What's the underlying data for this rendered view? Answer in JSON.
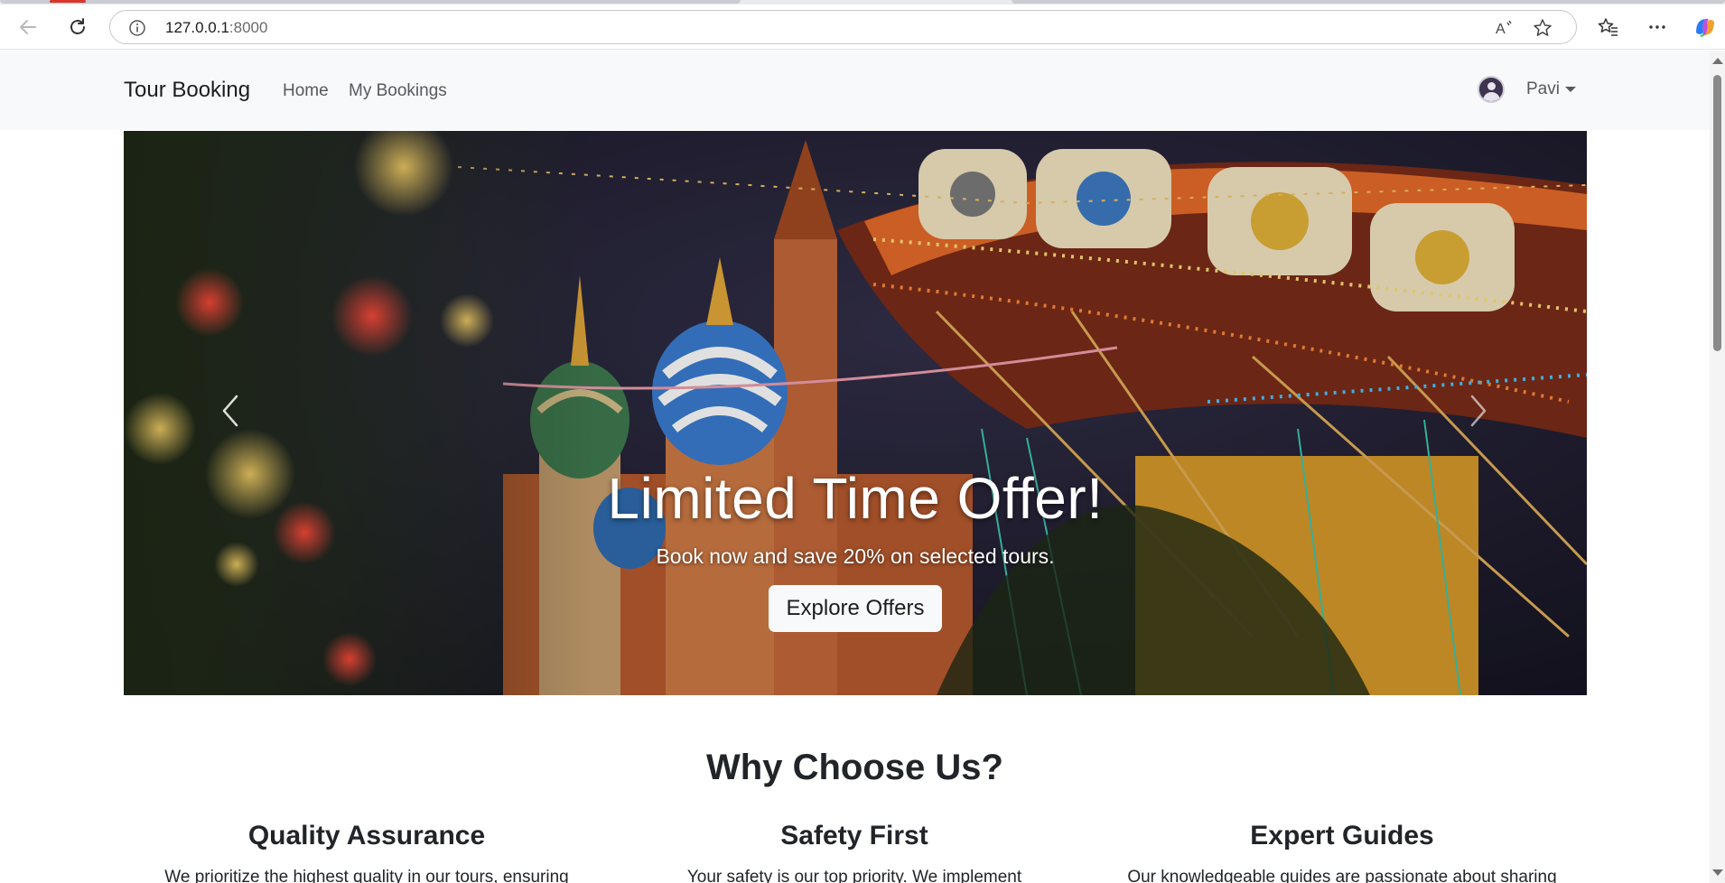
{
  "browser": {
    "url_host": "127.0.0.1",
    "url_port": ":8000"
  },
  "navbar": {
    "brand": "Tour Booking",
    "links": [
      "Home",
      "My Bookings"
    ],
    "user_name": "Pavi"
  },
  "hero": {
    "title": "Limited Time Offer!",
    "subtitle": "Book now and save 20% on selected tours.",
    "button": "Explore Offers"
  },
  "why": {
    "heading": "Why Choose Us?",
    "features": [
      {
        "title": "Quality Assurance",
        "text": "We prioritize the highest quality in our tours, ensuring"
      },
      {
        "title": "Safety First",
        "text": "Your safety is our top priority. We implement"
      },
      {
        "title": "Expert Guides",
        "text": "Our knowledgeable guides are passionate about sharing"
      }
    ]
  },
  "icons": {
    "back": "arrow-left-icon",
    "reload": "reload-icon",
    "info": "info-icon",
    "read_aloud": "read-aloud-icon",
    "favorite": "star-icon",
    "favorites": "favorites-icon",
    "more": "more-icon",
    "copilot": "copilot-icon",
    "prev": "chevron-left-icon",
    "next": "chevron-right-icon"
  },
  "colors": {
    "navbar_bg": "#f8f9fa",
    "text": "#212529",
    "nav_link": "#555a60"
  }
}
